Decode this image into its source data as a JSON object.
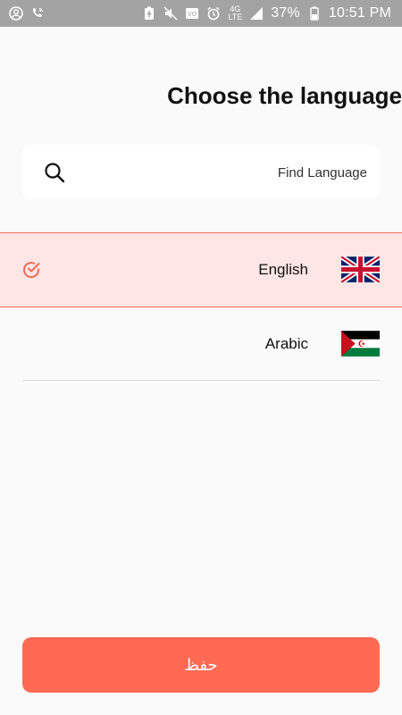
{
  "status_bar": {
    "battery": "37%",
    "time": "10:51 PM",
    "network_top": "4G",
    "network_bottom": "LTE"
  },
  "title": "Choose the language",
  "search": {
    "placeholder": "Find Language"
  },
  "languages": [
    {
      "label": "English",
      "flag": "uk-flag-icon",
      "selected": true
    },
    {
      "label": "Arabic",
      "flag": "western-sahara-flag-icon",
      "selected": false
    }
  ],
  "save_button": {
    "label": "حفظ"
  },
  "colors": {
    "accent": "#ff6a55",
    "selected_bg": "#fde6e4",
    "status_bar": "#a3a3a3"
  }
}
